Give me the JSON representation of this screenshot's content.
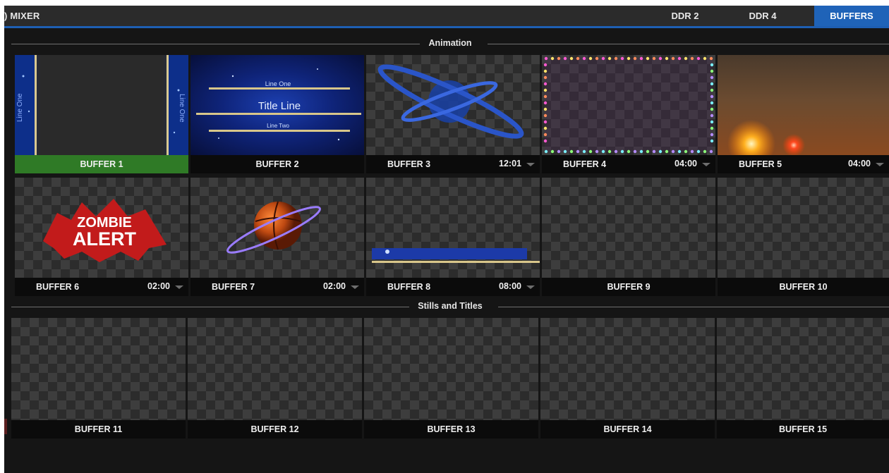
{
  "topbar": {
    "mixer_label": ") MIXER",
    "tabs": [
      {
        "label": "DDR 2",
        "active": false
      },
      {
        "label": "DDR 4",
        "active": false
      },
      {
        "label": "BUFFERS",
        "active": true
      }
    ]
  },
  "sections": {
    "animation": {
      "title": "Animation"
    },
    "stills": {
      "title": "Stills and Titles"
    }
  },
  "buffers": [
    {
      "name": "BUFFER 1",
      "duration": "",
      "selected": true,
      "thumbnail": "title-lower-third-vertical"
    },
    {
      "name": "BUFFER 2",
      "duration": "",
      "selected": false,
      "thumbnail": "title-line-blue"
    },
    {
      "name": "BUFFER 3",
      "duration": "12:01",
      "selected": false,
      "thumbnail": "blue-globe"
    },
    {
      "name": "BUFFER 4",
      "duration": "04:00",
      "selected": false,
      "thumbnail": "light-bulb-frame"
    },
    {
      "name": "BUFFER 5",
      "duration": "04:00",
      "selected": false,
      "thumbnail": "orange-glow"
    },
    {
      "name": "BUFFER 6",
      "duration": "02:00",
      "selected": false,
      "thumbnail": "zombie-alert"
    },
    {
      "name": "BUFFER 7",
      "duration": "02:00",
      "selected": false,
      "thumbnail": "basketball"
    },
    {
      "name": "BUFFER 8",
      "duration": "08:00",
      "selected": false,
      "thumbnail": "blue-lower-bar"
    },
    {
      "name": "BUFFER 9",
      "duration": "",
      "selected": false,
      "thumbnail": "empty"
    },
    {
      "name": "BUFFER 10",
      "duration": "",
      "selected": false,
      "thumbnail": "empty"
    },
    {
      "name": "BUFFER 11",
      "duration": "",
      "selected": false,
      "thumbnail": "empty"
    },
    {
      "name": "BUFFER 12",
      "duration": "",
      "selected": false,
      "thumbnail": "empty"
    },
    {
      "name": "BUFFER 13",
      "duration": "",
      "selected": false,
      "thumbnail": "empty"
    },
    {
      "name": "BUFFER 14",
      "duration": "",
      "selected": false,
      "thumbnail": "empty"
    },
    {
      "name": "BUFFER 15",
      "duration": "",
      "selected": false,
      "thumbnail": "empty"
    }
  ],
  "thumbnail_text": {
    "title_line": "Title Line",
    "line_one": "Line One",
    "line_two": "Line Two",
    "zombie": "ZOMBIE",
    "alert": "ALERT"
  },
  "colors": {
    "accent_blue": "#1f63b8",
    "selected_green": "#2f7a26",
    "background": "#151515"
  }
}
